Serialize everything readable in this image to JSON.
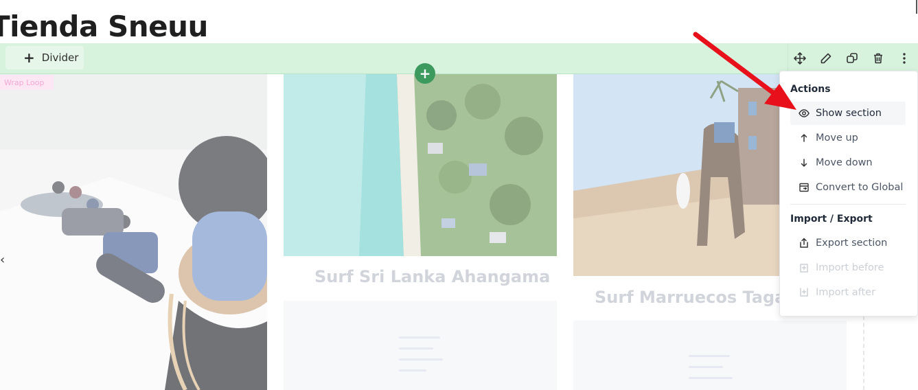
{
  "page": {
    "title": "Tienda Sneuu"
  },
  "toolbar": {
    "add_label": "Divider",
    "icons": [
      "move-icon",
      "edit-pencil-icon",
      "duplicate-icon",
      "trash-icon",
      "more-vertical-icon"
    ]
  },
  "section": {
    "wrap_label": "Wrap Loop"
  },
  "cards": [
    {
      "title": "Surf Sri Lanka Ahangama"
    },
    {
      "title": "Surf Marruecos Tagaze"
    }
  ],
  "menu": {
    "actions_heading": "Actions",
    "actions": [
      {
        "label": "Show section",
        "icon": "eye-icon",
        "state": "hover"
      },
      {
        "label": "Move up",
        "icon": "arrow-up-icon",
        "state": "enabled"
      },
      {
        "label": "Move down",
        "icon": "arrow-down-icon",
        "state": "enabled"
      },
      {
        "label": "Convert to Global",
        "icon": "global-convert-icon",
        "state": "enabled"
      }
    ],
    "io_heading": "Import / Export",
    "io": [
      {
        "label": "Export section",
        "icon": "export-icon",
        "state": "enabled"
      },
      {
        "label": "Import before",
        "icon": "import-before-icon",
        "state": "disabled"
      },
      {
        "label": "Import after",
        "icon": "import-after-icon",
        "state": "disabled"
      }
    ]
  },
  "colors": {
    "toolbar_bg": "#d7f3de",
    "add_circle": "#3d9a5f",
    "annotation_arrow": "#e8101a"
  }
}
